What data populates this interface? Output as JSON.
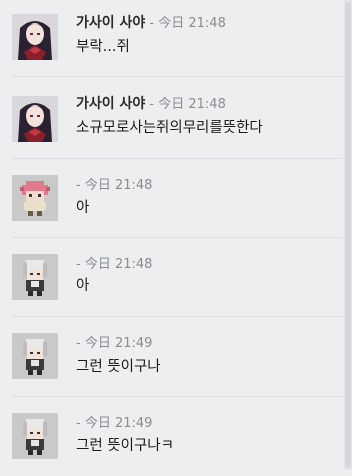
{
  "messages": [
    {
      "author": "가사이 사야",
      "time": "- 今日 21:48",
      "text": "부락...쥐",
      "avatar": "dark-haired-girl-avatar"
    },
    {
      "author": "가사이 사야",
      "time": "- 今日 21:48",
      "text": "소규모로사는쥐의무리를뜻한다",
      "avatar": "dark-haired-girl-avatar"
    },
    {
      "author": "",
      "time": "- 今日 21:48",
      "text": "아",
      "avatar": "pink-haired-pixel-avatar"
    },
    {
      "author": "",
      "time": "- 今日 21:48",
      "text": "아",
      "avatar": "grey-haired-pixel-avatar"
    },
    {
      "author": "",
      "time": "- 今日 21:49",
      "text": "그런 뜻이구나",
      "avatar": "grey-haired-pixel-avatar"
    },
    {
      "author": "",
      "time": "- 今日 21:49",
      "text": "그런 뜻이구나ㅋ",
      "avatar": "grey-haired-pixel-avatar"
    }
  ],
  "colors": {
    "background": "#eceeef",
    "divider": "#dcdfe1",
    "timestamp": "#8a8d90"
  }
}
